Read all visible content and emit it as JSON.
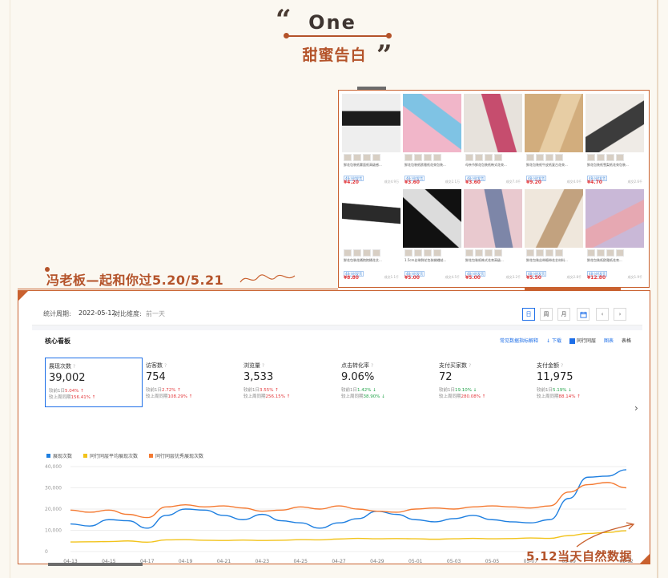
{
  "header": {
    "title": "One",
    "subtitle": "甜蜜告白"
  },
  "promo_line": "冯老板—起和你过5.20/5.21",
  "annotation": "5.12当天自然数据",
  "products": [
    {
      "title": "鲜花包装纸雾面纸高级感...",
      "tag": "48小时发货",
      "price": "¥4.20",
      "sold": "成交4.9万",
      "img_colors": [
        "#eeeeee",
        "#1c1c1c"
      ]
    },
    {
      "title": "鲜花包装纸欧雅纸花束包装...",
      "tag": "48小时发货",
      "price": "¥3.60",
      "sold": "成交2.1万",
      "img_colors": [
        "#f1b6c9",
        "#7fc3e4"
      ]
    },
    {
      "title": "母亲节鲜花包装纸韩式花束...",
      "tag": "48小时发货",
      "price": "¥3.60",
      "sold": "成交7.4千",
      "img_colors": [
        "#e7e2dc",
        "#c64d6e"
      ]
    },
    {
      "title": "鲜花包装纸牛皮纸复古花束...",
      "tag": "48小时发货",
      "price": "¥9.20",
      "sold": "成交4.0千",
      "img_colors": [
        "#d2ad7d",
        "#e7cda4"
      ]
    },
    {
      "title": "鲜花包装纸雪梨纸花束包装...",
      "tag": "48小时发货",
      "price": "¥4.70",
      "sold": "成交2.6千",
      "img_colors": [
        "#efebe6",
        "#3c3c3c"
      ]
    },
    {
      "title": "鲜花包装花桶抱抱桶花艺...",
      "tag": "48小时发货",
      "price": "¥8.80",
      "sold": "成交1.1千",
      "img_colors": [
        "#ffffff",
        "#2a2a2a"
      ]
    },
    {
      "title": "1.5cm丝带鲜花包装蝴蝶结...",
      "tag": "48小时发货",
      "price": "¥5.00",
      "sold": "成交4.5千",
      "img_colors": [
        "#111111",
        "#dcdcdc"
      ]
    },
    {
      "title": "鲜花包装纸韩式花束高级...",
      "tag": "48小时发货",
      "price": "¥5.00",
      "sold": "成交3.2千",
      "img_colors": [
        "#e9c9cf",
        "#7d86a8"
      ]
    },
    {
      "title": "鲜花包装丝带缎带花艺材料...",
      "tag": "48小时发货",
      "price": "¥5.50",
      "sold": "成交2.8千",
      "img_colors": [
        "#efe7dc",
        "#c2a27f"
      ]
    },
    {
      "title": "鲜花包装纸欧雅纸花束...",
      "tag": "48小时发货",
      "price": "¥12.80",
      "sold": "成交1.9千",
      "img_colors": [
        "#c9b8d7",
        "#e6a8b2"
      ]
    }
  ],
  "dashboard": {
    "period_label": "统计周期:",
    "period_value": "2022-05-12",
    "compare_label": "对比维度:",
    "compare_value": "前一天",
    "buttons": [
      "日",
      "周",
      "月"
    ],
    "panel_title": "核心看板",
    "links": {
      "explain": "常见数据指标解释",
      "download": "下载",
      "peer": "同行同层",
      "chart": "图表",
      "table": "表格"
    },
    "metrics": [
      {
        "name": "展现次数",
        "value": "39,002",
        "day_label": "较前1日",
        "day": "5.04%",
        "day_dir": "up",
        "week_label": "较上周同期",
        "week": "156.41%",
        "week_dir": "up"
      },
      {
        "name": "访客数",
        "value": "754",
        "day_label": "较前1日",
        "day": "2.72%",
        "day_dir": "up",
        "week_label": "较上周同期",
        "week": "108.29%",
        "week_dir": "up"
      },
      {
        "name": "浏览量",
        "value": "3,533",
        "day_label": "较前1日",
        "day": "3.55%",
        "day_dir": "up",
        "week_label": "较上周同期",
        "week": "256.15%",
        "week_dir": "up"
      },
      {
        "name": "点击转化率",
        "value": "9.06%",
        "day_label": "较前1日",
        "day": "1.42%",
        "day_dir": "down",
        "week_label": "较上周同期",
        "week": "38.90%",
        "week_dir": "down"
      },
      {
        "name": "支付买家数",
        "value": "72",
        "day_label": "较前1日",
        "day": "19.10%",
        "day_dir": "down",
        "week_label": "较上周同期",
        "week": "280.08%",
        "week_dir": "up"
      },
      {
        "name": "支付金额",
        "value": "11,975",
        "day_label": "较前1日",
        "day": "5.19%",
        "day_dir": "down",
        "week_label": "较上周同期",
        "week": "88.14%",
        "week_dir": "up"
      }
    ]
  },
  "chart_data": {
    "type": "line",
    "x": [
      "04-13",
      "04-14",
      "04-15",
      "04-16",
      "04-17",
      "04-18",
      "04-19",
      "04-20",
      "04-21",
      "04-22",
      "04-23",
      "04-24",
      "04-25",
      "04-26",
      "04-27",
      "04-28",
      "04-29",
      "04-30",
      "05-01",
      "05-02",
      "05-03",
      "05-04",
      "05-05",
      "05-06",
      "05-07",
      "05-08",
      "05-09",
      "05-10",
      "05-11",
      "05-12"
    ],
    "x_ticks": [
      "04-13",
      "04-15",
      "04-17",
      "04-19",
      "04-21",
      "04-23",
      "04-25",
      "04-27",
      "04-29",
      "05-01",
      "05-03",
      "05-05",
      "05-07",
      "05-09",
      "05-12"
    ],
    "y_ticks": [
      "40,000",
      "30,000",
      "20,000",
      "10,000",
      "0"
    ],
    "ylim": [
      0,
      40000
    ],
    "series": [
      {
        "name": "展现次数",
        "color": "#1e7fe0",
        "values": [
          13000,
          12000,
          15000,
          14500,
          11000,
          17000,
          20000,
          19500,
          17000,
          15000,
          17500,
          14500,
          13500,
          11000,
          13500,
          15500,
          19000,
          17500,
          15000,
          14000,
          15500,
          17000,
          15000,
          14000,
          13500,
          15000,
          25000,
          35000,
          35500,
          38500
        ]
      },
      {
        "name": "同行同层平均展现次数",
        "color": "#f2c31b",
        "values": [
          4500,
          4600,
          4700,
          5000,
          4400,
          5500,
          5600,
          5300,
          5200,
          5400,
          5200,
          5300,
          5600,
          5500,
          5900,
          6200,
          6000,
          6100,
          6000,
          5800,
          6000,
          6200,
          6000,
          6100,
          6400,
          6200,
          7500,
          8500,
          9000,
          9800
        ]
      },
      {
        "name": "同行同层优秀展现次数",
        "color": "#f47a32",
        "values": [
          19500,
          18500,
          19500,
          17500,
          16000,
          21000,
          22000,
          21000,
          21500,
          20500,
          19000,
          19500,
          21000,
          20000,
          21500,
          20000,
          19000,
          18500,
          20000,
          20500,
          20000,
          21000,
          21500,
          21000,
          20500,
          21500,
          28000,
          31500,
          32500,
          30000
        ]
      }
    ]
  }
}
